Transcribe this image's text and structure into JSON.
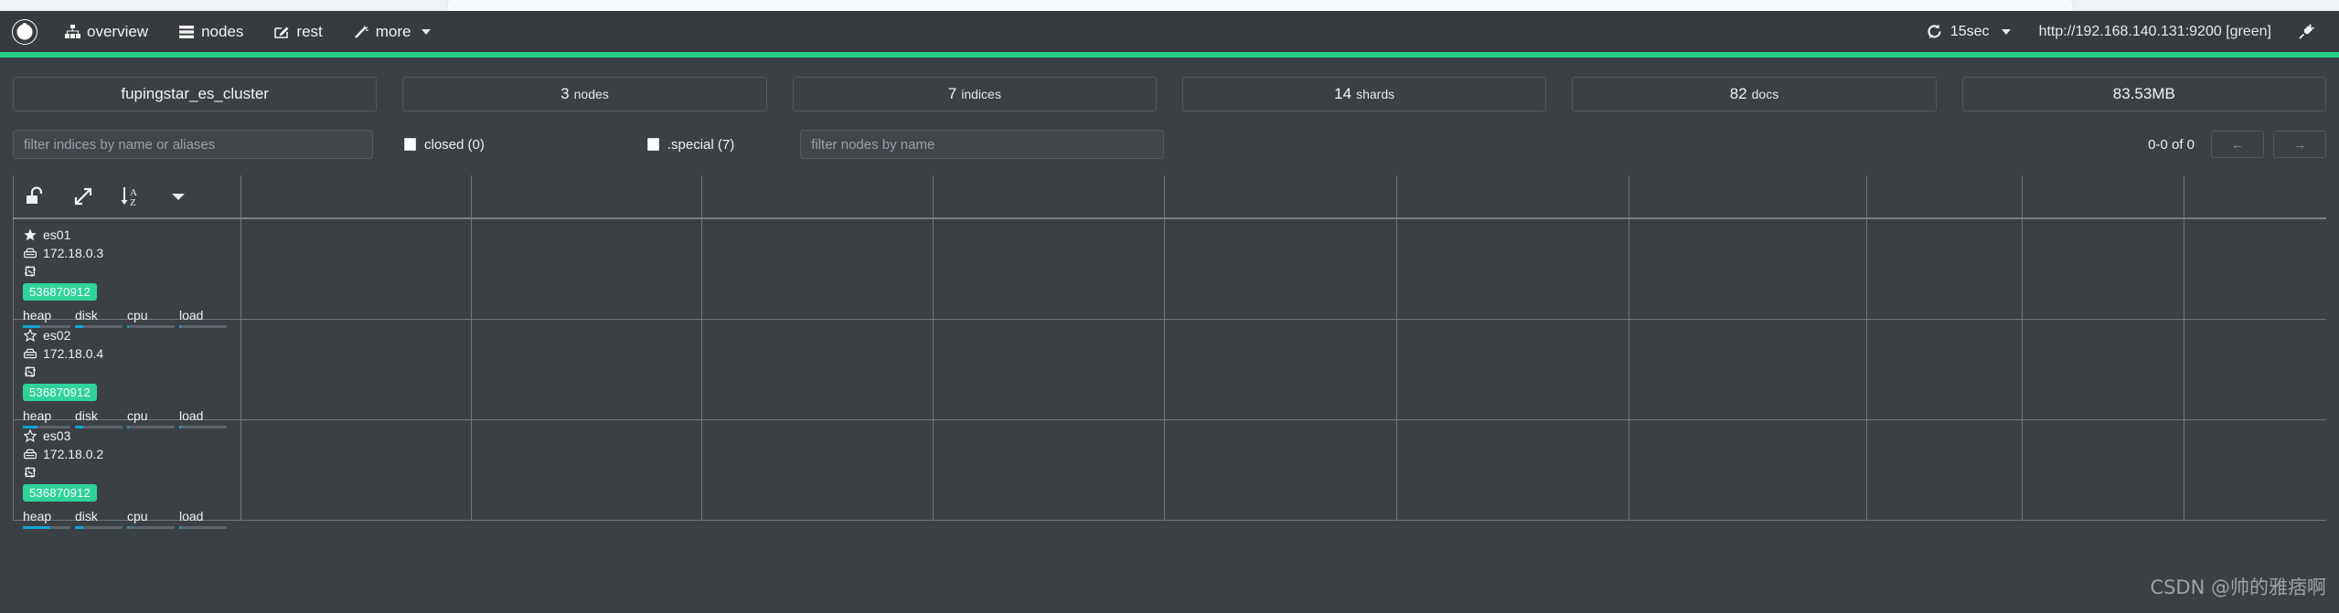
{
  "navbar": {
    "brand_icon": "elasticsearch-hq-logo-icon",
    "items": [
      {
        "label": "overview",
        "icon": "sitemap-icon"
      },
      {
        "label": "nodes",
        "icon": "server-list-icon"
      },
      {
        "label": "rest",
        "icon": "edit-square-icon"
      },
      {
        "label": "more",
        "icon": "magic-wand-icon",
        "has_caret": true
      }
    ],
    "refresh": {
      "label": "15sec",
      "icon": "refresh-icon",
      "has_caret": true
    },
    "cluster_url": "http://192.168.140.131:9200 [green]",
    "plug_icon": "plug-disconnect-icon"
  },
  "health": {
    "status": "green",
    "color": "#27d18b"
  },
  "stats": [
    {
      "name": "cluster-name",
      "value": "fupingstar_es_cluster",
      "label": ""
    },
    {
      "name": "nodes-count",
      "value": "3",
      "label": "nodes"
    },
    {
      "name": "indices-count",
      "value": "7",
      "label": "indices"
    },
    {
      "name": "shards-count",
      "value": "14",
      "label": "shards"
    },
    {
      "name": "docs-count",
      "value": "82",
      "label": "docs"
    },
    {
      "name": "store-size",
      "value": "83.53MB",
      "label": ""
    }
  ],
  "filters": {
    "indices_placeholder": "filter indices by name or aliases",
    "indices_value": "",
    "nodes_placeholder": "filter nodes by name",
    "nodes_value": "",
    "closed_label": "closed (0)",
    "closed_checked": false,
    "special_label": ".special (7)",
    "special_checked": false,
    "pager_label": "0-0 of 0",
    "prev_label": "←",
    "next_label": "→"
  },
  "toolbar": [
    {
      "name": "unlock-icon",
      "title": "unlock"
    },
    {
      "name": "expand-arrows-icon",
      "title": "expand"
    },
    {
      "name": "sort-alpha-asc-icon",
      "title": "sort A-Z"
    },
    {
      "name": "chevron-down-icon",
      "title": "more options"
    }
  ],
  "nodes": [
    {
      "name": "es01",
      "master": true,
      "star_icon": "star-filled-icon",
      "host_icon": "server-icon",
      "host": "172.18.0.3",
      "role_icon": "node-role-icon",
      "heap_badge": "536870912",
      "metrics": [
        {
          "label": "heap",
          "pct": 36
        },
        {
          "label": "disk",
          "pct": 18
        },
        {
          "label": "cpu",
          "pct": 3
        },
        {
          "label": "load",
          "pct": 4
        }
      ]
    },
    {
      "name": "es02",
      "master": false,
      "star_icon": "star-outline-icon",
      "host_icon": "server-icon",
      "host": "172.18.0.4",
      "role_icon": "node-role-icon",
      "heap_badge": "536870912",
      "metrics": [
        {
          "label": "heap",
          "pct": 30
        },
        {
          "label": "disk",
          "pct": 18
        },
        {
          "label": "cpu",
          "pct": 3
        },
        {
          "label": "load",
          "pct": 4
        }
      ]
    },
    {
      "name": "es03",
      "master": false,
      "star_icon": "star-outline-icon",
      "host_icon": "server-icon",
      "host": "172.18.0.2",
      "role_icon": "node-role-icon",
      "heap_badge": "536870912",
      "metrics": [
        {
          "label": "heap",
          "pct": 58
        },
        {
          "label": "disk",
          "pct": 18
        },
        {
          "label": "cpu",
          "pct": 3
        },
        {
          "label": "load",
          "pct": 4
        }
      ]
    }
  ],
  "watermark": "CSDN @帅的雅痞啊",
  "colors": {
    "accent_green": "#27d18b",
    "badge_green": "#2fd39a",
    "bar_blue": "#14a5d6",
    "bg": "#3b4044",
    "navbar_bg": "#373b3e"
  }
}
